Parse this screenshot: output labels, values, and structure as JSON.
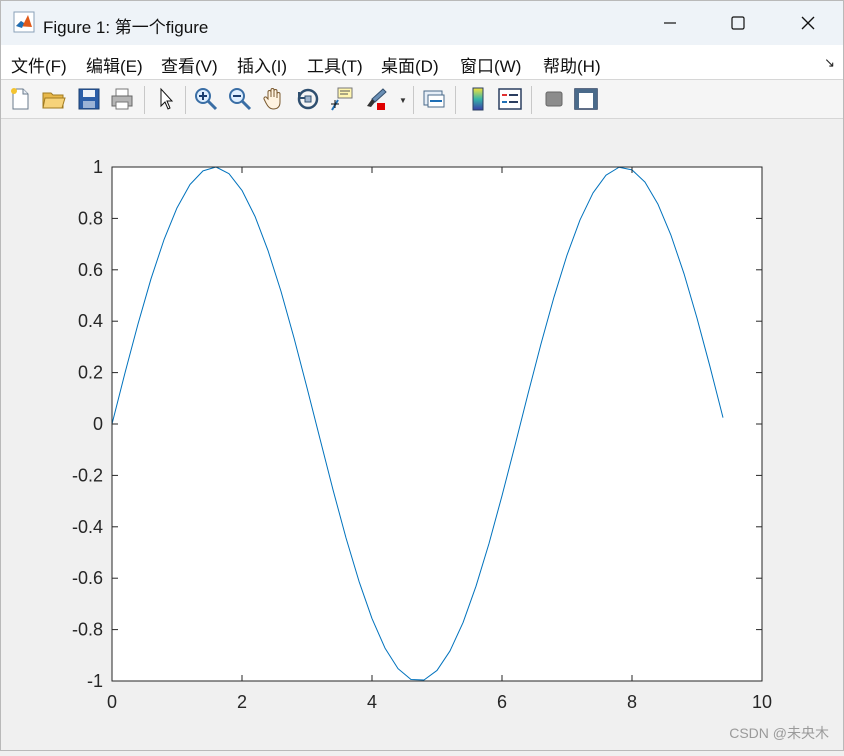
{
  "window": {
    "title": "Figure 1: 第一个figure",
    "icon": "matlab-logo-icon",
    "controls": [
      "minimize-icon",
      "maximize-icon",
      "close-icon"
    ]
  },
  "menubar": {
    "items": [
      {
        "label": "文件(F)"
      },
      {
        "label": "编辑(E)"
      },
      {
        "label": "查看(V)"
      },
      {
        "label": "插入(I)"
      },
      {
        "label": "工具(T)"
      },
      {
        "label": "桌面(D)"
      },
      {
        "label": "窗口(W)"
      },
      {
        "label": "帮助(H)"
      }
    ],
    "dock_arrow": "↘"
  },
  "toolbar": {
    "icons": [
      "new-figure-icon",
      "open-file-icon",
      "save-icon",
      "print-icon",
      "edit-plot-pointer-icon",
      "zoom-in-icon",
      "zoom-out-icon",
      "pan-hand-icon",
      "rotate-3d-icon",
      "data-cursor-icon",
      "brush-icon",
      "link-plot-icon",
      "insert-colorbar-icon",
      "insert-legend-icon",
      "hide-plot-tools-icon",
      "show-plot-tools-icon"
    ]
  },
  "chart_data": {
    "type": "line",
    "function": "sin(x)",
    "x": [
      0.0,
      0.2,
      0.4,
      0.6,
      0.8,
      1.0,
      1.2,
      1.4,
      1.6,
      1.8,
      2.0,
      2.2,
      2.4,
      2.6,
      2.8,
      3.0,
      3.2,
      3.4,
      3.6,
      3.8,
      4.0,
      4.2,
      4.4,
      4.6,
      4.8,
      5.0,
      5.2,
      5.4,
      5.6,
      5.8,
      6.0,
      6.2,
      6.4,
      6.6,
      6.8,
      7.0,
      7.2,
      7.4,
      7.6,
      7.8,
      8.0,
      8.2,
      8.4,
      8.6,
      8.8,
      9.0,
      9.2,
      9.4
    ],
    "y": [
      0.0,
      0.199,
      0.389,
      0.565,
      0.717,
      0.841,
      0.932,
      0.985,
      1.0,
      0.974,
      0.909,
      0.808,
      0.675,
      0.516,
      0.335,
      0.141,
      -0.058,
      -0.256,
      -0.443,
      -0.612,
      -0.757,
      -0.872,
      -0.952,
      -0.994,
      -0.996,
      -0.959,
      -0.883,
      -0.773,
      -0.631,
      -0.465,
      -0.279,
      -0.083,
      0.117,
      0.312,
      0.494,
      0.657,
      0.794,
      0.899,
      0.968,
      0.999,
      0.989,
      0.941,
      0.855,
      0.734,
      0.585,
      0.412,
      0.223,
      0.025
    ],
    "xlim": [
      0,
      10
    ],
    "ylim": [
      -1,
      1
    ],
    "xticks": [
      "0",
      "2",
      "4",
      "6",
      "8",
      "10"
    ],
    "yticks": [
      "1",
      "0.8",
      "0.6",
      "0.4",
      "0.2",
      "0",
      "-0.2",
      "-0.4",
      "-0.6",
      "-0.8",
      "-1"
    ],
    "title": "",
    "xlabel": "",
    "ylabel": "",
    "line_color": "#0072bd",
    "grid": false,
    "box": true
  },
  "watermark": "CSDN @未央木"
}
